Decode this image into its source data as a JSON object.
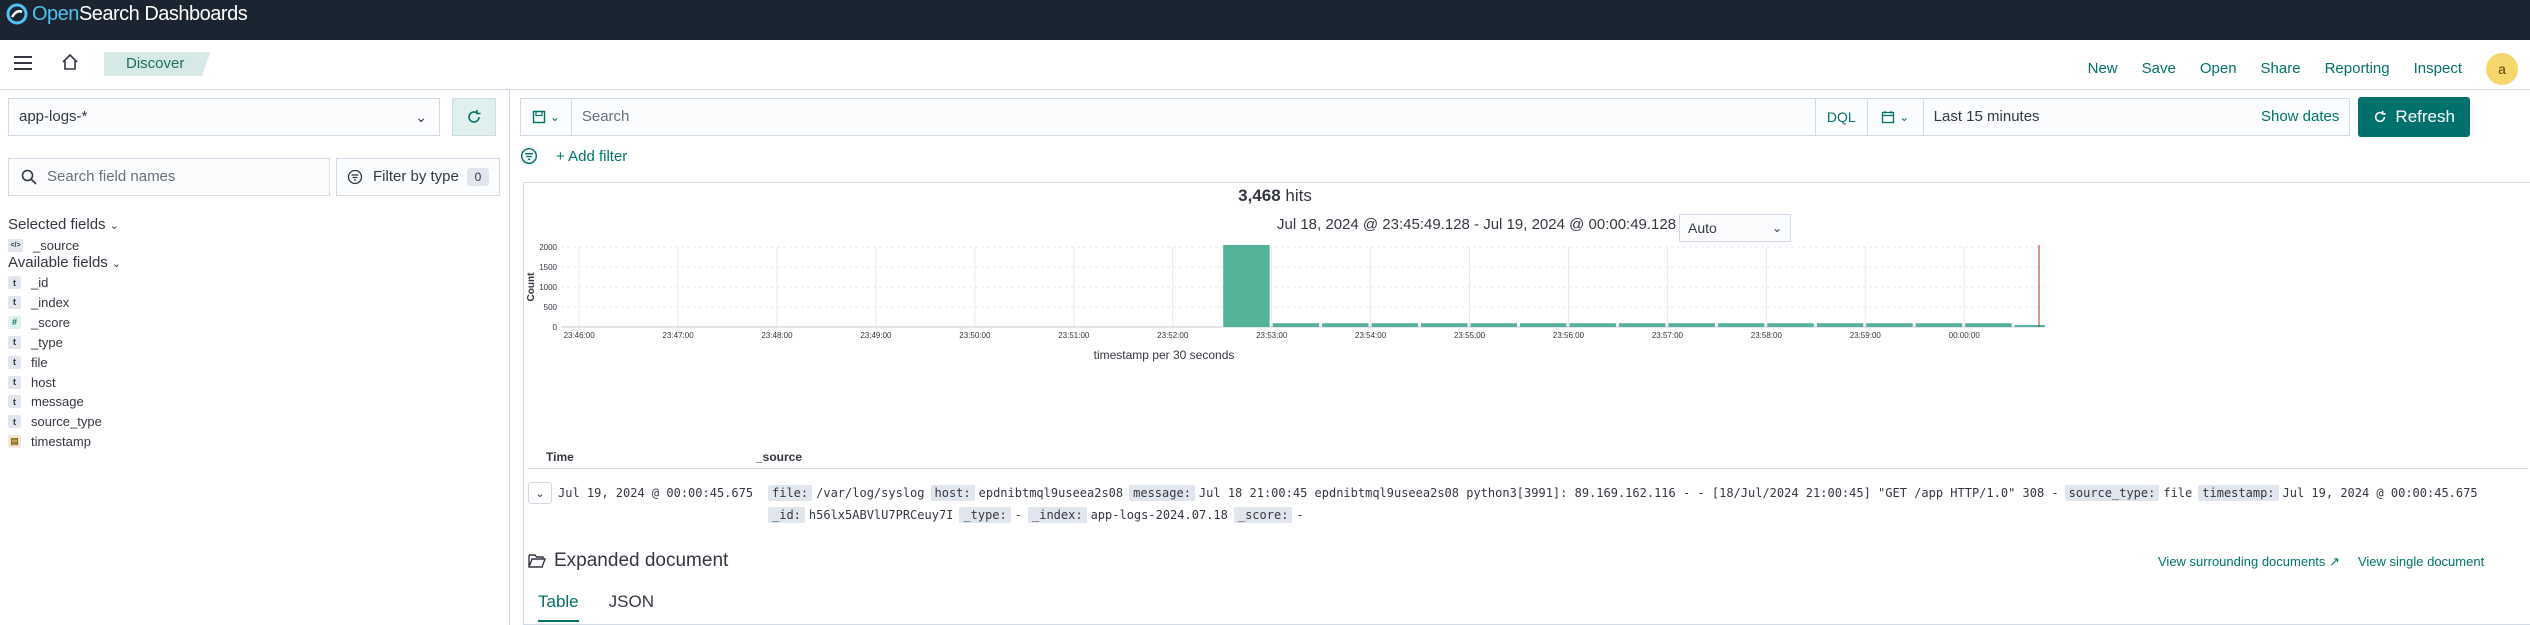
{
  "app": {
    "title": "OpenSearch Dashboards",
    "title_open": "Open",
    "title_rest": "Search Dashboards"
  },
  "breadcrumb": "Discover",
  "topnav": {
    "new": "New",
    "save": "Save",
    "open": "Open",
    "share": "Share",
    "reporting": "Reporting",
    "inspect": "Inspect",
    "avatar": "a"
  },
  "sidebar": {
    "index_pattern": "app-logs-*",
    "search_placeholder": "Search field names",
    "filter_by_type": "Filter by type",
    "filter_count": "0",
    "selected_title": "Selected fields",
    "selected_fields": [
      {
        "name": "_source",
        "type": "src"
      }
    ],
    "available_title": "Available fields",
    "available_fields": [
      {
        "name": "_id",
        "type": "t"
      },
      {
        "name": "_index",
        "type": "t"
      },
      {
        "name": "_score",
        "type": "#"
      },
      {
        "name": "_type",
        "type": "t"
      },
      {
        "name": "file",
        "type": "t"
      },
      {
        "name": "host",
        "type": "t"
      },
      {
        "name": "message",
        "type": "t"
      },
      {
        "name": "source_type",
        "type": "t"
      },
      {
        "name": "timestamp",
        "type": "date"
      }
    ]
  },
  "query": {
    "placeholder": "Search",
    "language": "DQL",
    "time_range": "Last 15 minutes",
    "show_dates": "Show dates",
    "refresh": "Refresh",
    "add_filter": "+ Add filter"
  },
  "results": {
    "hits": "3,468",
    "hits_label": "hits",
    "range": "Jul 18, 2024 @ 23:45:49.128 - Jul 19, 2024 @ 00:00:49.128 per",
    "interval": "Auto"
  },
  "chart_data": {
    "type": "bar",
    "ylabel": "Count",
    "xlabel": "timestamp per 30 seconds",
    "ylim": [
      0,
      2000
    ],
    "yticks": [
      0,
      500,
      1000,
      1500,
      2000
    ],
    "xticks": [
      "23:46:00",
      "23:47:00",
      "23:48:00",
      "23:49:00",
      "23:50:00",
      "23:51:00",
      "23:52:00",
      "23:53:00",
      "23:54:00",
      "23:55:00",
      "23:56:00",
      "23:57:00",
      "23:58:00",
      "23:59:00",
      "00:00:00"
    ],
    "categories": [
      "23:52:30",
      "23:53:00",
      "23:53:30",
      "23:54:00",
      "23:54:30",
      "23:55:00",
      "23:55:30",
      "23:56:00",
      "23:56:30",
      "23:57:00",
      "23:57:30",
      "23:58:00",
      "23:58:30",
      "23:59:00",
      "23:59:30",
      "00:00:00",
      "00:00:30"
    ],
    "values": [
      2050,
      95,
      95,
      95,
      95,
      95,
      95,
      95,
      95,
      95,
      95,
      95,
      95,
      95,
      95,
      95,
      50
    ],
    "grid": true,
    "color": "#54b399"
  },
  "table": {
    "col_time": "Time",
    "col_source": "_source",
    "row": {
      "time": "Jul 19, 2024 @ 00:00:45.675",
      "line1": [
        {
          "k": "file:",
          "v": "/var/log/syslog"
        },
        {
          "k": "host:",
          "v": "epdnibtmql9useea2s08"
        },
        {
          "k": "message:",
          "v": "Jul 18 21:00:45 epdnibtmql9useea2s08 python3[3991]: 89.169.162.116 - - [18/Jul/2024 21:00:45] \"GET /app HTTP/1.0\" 308 -"
        },
        {
          "k": "source_type:",
          "v": "file"
        },
        {
          "k": "timestamp:",
          "v": "Jul 19, 2024 @ 00:00:45.675"
        }
      ],
      "line2": [
        {
          "k": "_id:",
          "v": "h56lx5ABVlU7PRCeuy7I"
        },
        {
          "k": "_type:",
          "v": "-"
        },
        {
          "k": "_index:",
          "v": "app-logs-2024.07.18"
        },
        {
          "k": "_score:",
          "v": "-"
        }
      ]
    }
  },
  "expanded": {
    "title": "Expanded document",
    "surrounding": "View surrounding documents",
    "single": "View single document",
    "tab_table": "Table",
    "tab_json": "JSON"
  }
}
